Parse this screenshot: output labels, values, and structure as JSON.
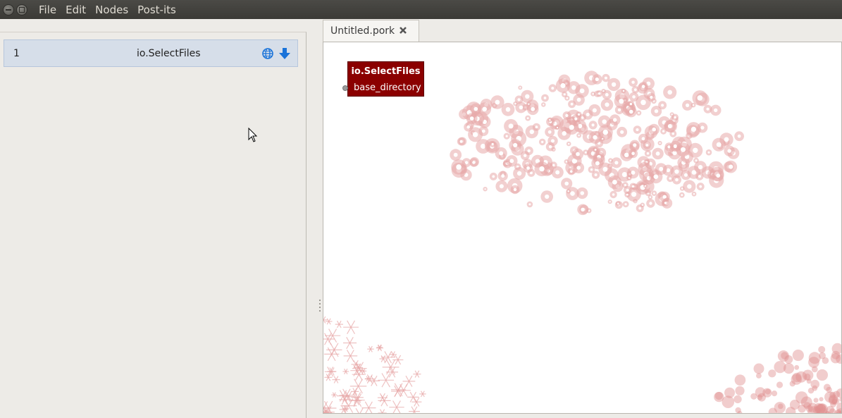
{
  "menubar": {
    "items": [
      "File",
      "Edit",
      "Nodes",
      "Post-its"
    ]
  },
  "node_list": {
    "rows": [
      {
        "index": "1",
        "name": "io.SelectFiles",
        "icons": [
          "globe-icon",
          "download-icon"
        ]
      }
    ]
  },
  "tabs": [
    {
      "label": "Untitled.pork",
      "close_icon": "close-icon"
    }
  ],
  "canvas": {
    "node": {
      "title": "io.SelectFiles",
      "port": "base_directory"
    }
  },
  "colors": {
    "menubar": "#3f3e3a",
    "node_fill": "#8b0000",
    "selected_row": "#d6dee9",
    "accent_blue": "#1a73d9",
    "watermark": "#e8a9a9"
  }
}
